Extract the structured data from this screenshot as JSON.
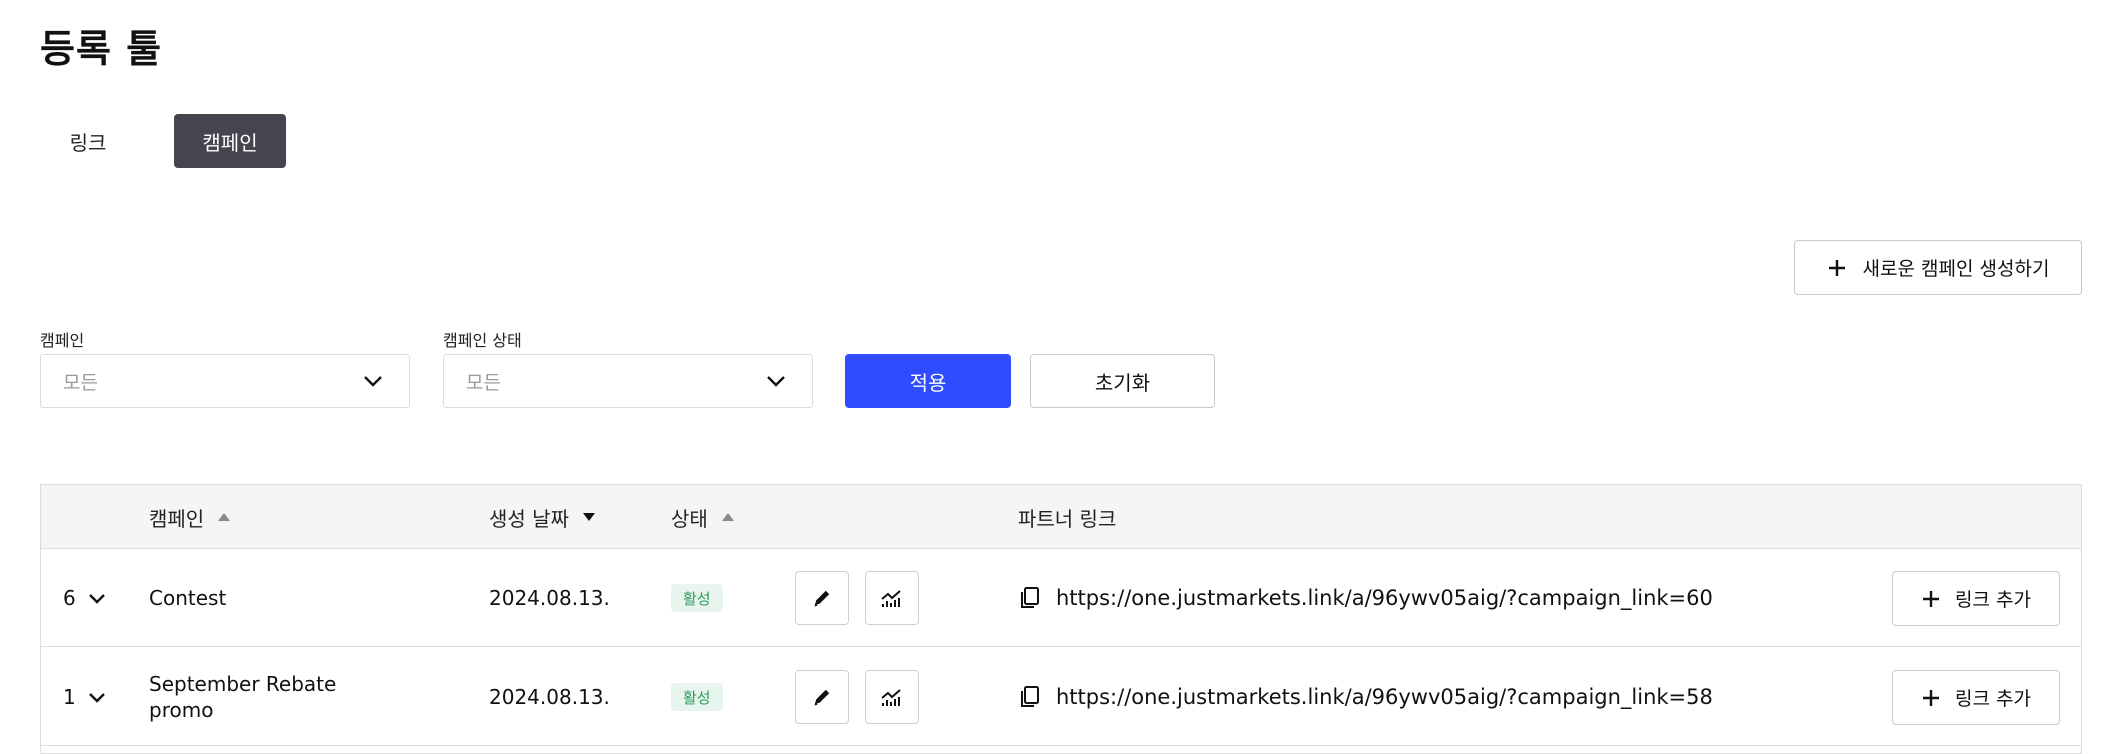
{
  "page_title": "등록 툴",
  "tabs": [
    {
      "label": "링크",
      "active": false
    },
    {
      "label": "캠페인",
      "active": true
    }
  ],
  "new_campaign_button": "새로운 캠페인 생성하기",
  "filters": {
    "campaign_label": "캠페인",
    "campaign_value": "모든",
    "status_label": "캠페인 상태",
    "status_value": "모든",
    "apply_label": "적용",
    "reset_label": "초기화"
  },
  "table": {
    "headers": {
      "campaign": "캠페인",
      "created": "생성 날짜",
      "status": "상태",
      "partner_link": "파트너 링크"
    },
    "rows": [
      {
        "count": "6",
        "name": "Contest",
        "date": "2024.08.13.",
        "status": "활성",
        "link": "https://one.justmarkets.link/a/96ywv05aig/?campaign_link=60",
        "add_link_label": "링크 추가"
      },
      {
        "count": "1",
        "name": "September Rebate promo",
        "date": "2024.08.13.",
        "status": "활성",
        "link": "https://one.justmarkets.link/a/96ywv05aig/?campaign_link=58",
        "add_link_label": "링크 추가"
      }
    ]
  },
  "colors": {
    "primary": "#2f4dff",
    "active_tab": "#46454f",
    "status_badge_bg": "#e7f5ee",
    "status_badge_text": "#2b9a5b"
  },
  "icons": {
    "plus": "plus-icon",
    "chevron": "chevron-down-icon",
    "sort_up": "sort-up-icon",
    "sort_down": "sort-down-icon",
    "edit": "pencil-icon",
    "stats": "chart-icon",
    "copy": "copy-icon"
  }
}
